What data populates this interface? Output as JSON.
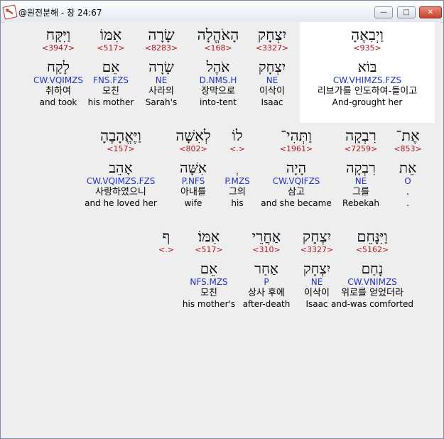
{
  "window": {
    "title": "@원전분해 - 창 24:67",
    "buttons": {
      "minimize": "—",
      "maximize": "□",
      "close": "✕"
    },
    "icon": "app-logo-icon"
  },
  "lines": [
    [
      {
        "heb": "וַיְבִאֶהָ",
        "strong": "<935>",
        "lemma": "בּוֹא",
        "parse": "CW.VHIMZS.FZS",
        "kor": "리브가를 인도하여-들이고",
        "eng": "And-grought her"
      },
      {
        "heb": "יִצְחָק",
        "strong": "<3327>",
        "lemma": "יִצְחָק",
        "parse": "NE",
        "kor": "이삭이",
        "eng": "Isaac"
      },
      {
        "heb": "הָאֹהֱלָה",
        "strong": "<168>",
        "lemma": "אֹהֶל",
        "parse": "D.NMS.H",
        "kor": "장막으로",
        "eng": "into-tent"
      },
      {
        "heb": "שָׂרָה",
        "strong": "<8283>",
        "lemma": "שָׂרָה",
        "parse": "NE",
        "kor": "사라의",
        "eng": "Sarah's"
      },
      {
        "heb": "אִמּוֹ",
        "strong": "<517>",
        "lemma": "אֵם",
        "parse": "FNS.FZS",
        "kor": "모친",
        "eng": "his mother"
      },
      {
        "heb": "וַיִּקַּח",
        "strong": "<3947>",
        "lemma": "לָקַח",
        "parse": "CW.VQIMZS",
        "kor": "취하여",
        "eng": "and took"
      }
    ],
    [
      {
        "heb": "אֶת־",
        "strong": "<853>",
        "lemma": "אֵת",
        "parse": "O",
        "kor": ".",
        "eng": "."
      },
      {
        "heb": "רִבְקָה",
        "strong": "<7259>",
        "lemma": "רִבְקָה",
        "parse": "NE",
        "kor": "그를",
        "eng": "Rebekah"
      },
      {
        "heb": "וַתְּהִי־",
        "strong": "<1961>",
        "lemma": "הָיָה",
        "parse": "CW.VQIFZS",
        "kor": "삼고",
        "eng": "and she became"
      },
      {
        "heb": "לוֹ",
        "strong": "<.>",
        "lemma": "ְ",
        "parse": "P.MZS",
        "kor": "그의",
        "eng": "his"
      },
      {
        "heb": "לְאִשָּׁה",
        "strong": "<802>",
        "lemma": "אִשָּׁה",
        "parse": "P.NFS",
        "kor": "아내를",
        "eng": "wife"
      },
      {
        "heb": "וַיֶּאֱהָבֶהָ",
        "strong": "<157>",
        "lemma": "אָהֵב",
        "parse": "CW.VQIMZS.FZS",
        "kor": "사랑하였으니",
        "eng": "and he loved her"
      }
    ],
    [
      {
        "heb": "וַיִּנָּחֵם",
        "strong": "<5162>",
        "lemma": "נָחַם",
        "parse": "CW.VNIMZS",
        "kor": "위로를 얻었더라",
        "eng": "and-was comforted"
      },
      {
        "heb": "יִצְחָק",
        "strong": "<3327>",
        "lemma": "יִצְחָק",
        "parse": "NE",
        "kor": "이삭이",
        "eng": "Isaac"
      },
      {
        "heb": "אַחֲרֵי",
        "strong": "<310>",
        "lemma": "אַחַר",
        "parse": "P",
        "kor": "상사 후에",
        "eng": "after-death"
      },
      {
        "heb": "אִמּוֹ׃",
        "strong": "<517>",
        "lemma": "אֵם",
        "parse": "NFS.MZS",
        "kor": "모친",
        "eng": "his mother's"
      },
      {
        "heb": "ף",
        "strong": "<.>",
        "lemma": "",
        "parse": "",
        "kor": "",
        "eng": ""
      }
    ]
  ]
}
